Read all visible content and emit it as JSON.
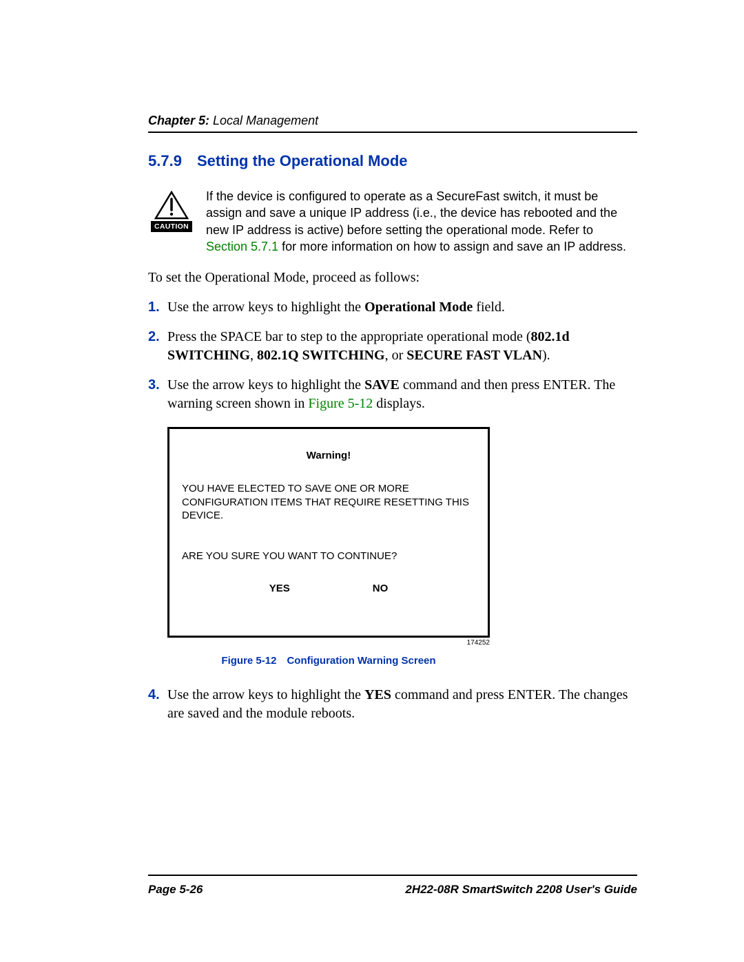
{
  "header": {
    "chapter_prefix": "Chapter 5:",
    "chapter_title": " Local Management"
  },
  "section": {
    "number": "5.7.9",
    "title": "Setting the Operational Mode"
  },
  "caution": {
    "label": "CAUTION",
    "text_pre": "If the device is configured to operate as a SecureFast switch, it must be assign and save a unique IP address (i.e., the device has rebooted and the new IP address is active) before setting the operational mode. Refer to ",
    "link": "Section 5.7.1",
    "text_post": " for more information on how to assign and save an IP address."
  },
  "intro": "To set the Operational Mode, proceed as follows:",
  "steps": [
    {
      "num": "1.",
      "pre": "Use the arrow keys to highlight the ",
      "bold1": "Operational Mode",
      "post": " field."
    },
    {
      "num": "2.",
      "pre": "Press the SPACE bar to step to the appropriate operational mode (",
      "bold1": "802.1d SWITCHING",
      "mid1": ", ",
      "bold2": "802.1Q SWITCHING",
      "mid2": ", or ",
      "bold3": "SECURE FAST VLAN",
      "post": ")."
    },
    {
      "num": "3.",
      "pre": "Use the arrow keys to highlight the ",
      "bold1": "SAVE",
      "mid1": " command and then press ENTER. The warning screen shown in ",
      "link": "Figure 5-12",
      "post": " displays."
    },
    {
      "num": "4.",
      "pre": "Use the arrow keys to highlight the ",
      "bold1": "YES",
      "post": " command and press ENTER. The changes are saved and the module reboots."
    }
  ],
  "figure": {
    "warning": "Warning!",
    "message": "YOU HAVE ELECTED TO SAVE ONE OR MORE CONFIGURATION ITEMS THAT REQUIRE RESETTING THIS DEVICE.",
    "confirm": "ARE YOU SURE YOU WANT TO CONTINUE?",
    "yes": "YES",
    "no": "NO",
    "ref_num": "174252",
    "caption": "Figure 5-12 Configuration Warning Screen"
  },
  "footer": {
    "page": "Page 5-26",
    "guide": "2H22-08R SmartSwitch 2208 User's Guide"
  }
}
